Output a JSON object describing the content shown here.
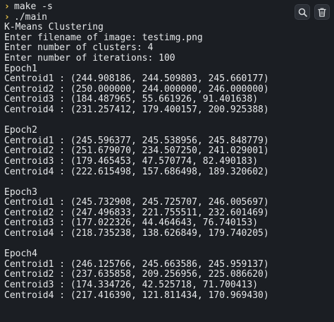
{
  "prompts": [
    {
      "symbol": "›",
      "command": "make -s"
    },
    {
      "symbol": "›",
      "command": "./main"
    }
  ],
  "toolbar": {
    "search_icon": "search-icon",
    "delete_icon": "trash-icon"
  },
  "output": {
    "title": "K-Means Clustering",
    "filename_prompt": "Enter filename of image: testimg.png",
    "clusters_prompt": "Enter number of clusters: 4",
    "iterations_prompt": "Enter number of iterations: 100"
  },
  "epochs": [
    {
      "label": "Epoch1",
      "centroids": [
        "Centroid1 : (244.908186, 244.509803, 245.660177)",
        "Centroid2 : (250.000000, 244.000000, 246.000000)",
        "Centroid3 : (184.487965, 55.661926, 91.401638)",
        "Centroid4 : (231.257412, 179.400157, 200.925388)"
      ]
    },
    {
      "label": "Epoch2",
      "centroids": [
        "Centroid1 : (245.596377, 245.538956, 245.848779)",
        "Centroid2 : (251.679070, 234.507250, 241.029001)",
        "Centroid3 : (179.465453, 47.570774, 82.490183)",
        "Centroid4 : (222.615498, 157.686498, 189.320602)"
      ]
    },
    {
      "label": "Epoch3",
      "centroids": [
        "Centroid1 : (245.732908, 245.725707, 246.005697)",
        "Centroid2 : (247.496833, 221.755511, 232.601469)",
        "Centroid3 : (177.022326, 44.464643, 76.740153)",
        "Centroid4 : (218.735238, 138.626849, 179.740205)"
      ]
    },
    {
      "label": "Epoch4",
      "centroids": [
        "Centroid1 : (246.125766, 245.663586, 245.959137)",
        "Centroid2 : (237.635858, 209.256956, 225.086620)",
        "Centroid3 : (174.334726, 42.525718, 71.700413)",
        "Centroid4 : (217.416390, 121.811434, 170.969430)"
      ]
    }
  ]
}
